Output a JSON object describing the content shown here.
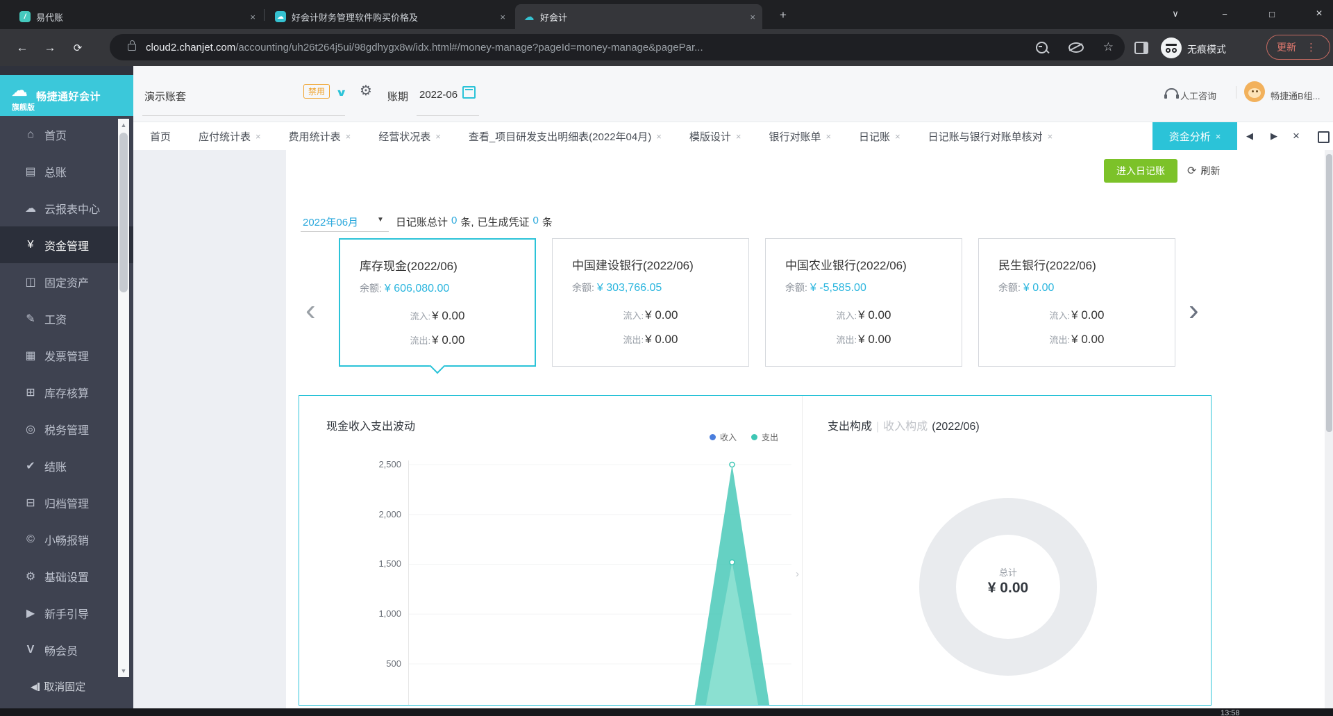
{
  "browser": {
    "tabs": [
      {
        "title": "易代账"
      },
      {
        "title": "好会计财务管理软件购买价格及"
      },
      {
        "title": "好会计"
      }
    ],
    "new_tab": "+",
    "close_glyph": "×",
    "window": {
      "tab_search": "∨",
      "minimize": "−",
      "maximize": "□",
      "close": "×"
    },
    "nav": {
      "back": "←",
      "forward": "→",
      "reload": "⟳"
    },
    "url": {
      "host": "cloud2.chanjet.com",
      "path": "/accounting/uh26t264j5ui/98gdhygx8w/idx.html#/money-manage?pageId=money-manage&pagePar..."
    },
    "star": "☆",
    "incognito_label": "无痕模式",
    "update_label": "更新",
    "menu_dots": "⋮"
  },
  "taskbar": {
    "time": "13:58"
  },
  "sidebar": {
    "logo_title": "畅捷通好会计",
    "logo_badge": "旗舰版",
    "logo_glyph": "☁",
    "items": [
      {
        "label": "首页",
        "icon": "home-icon",
        "glyph": "⌂"
      },
      {
        "label": "总账",
        "icon": "ledger-icon",
        "glyph": "▤"
      },
      {
        "label": "云报表中心",
        "icon": "cloud-report-icon",
        "glyph": "☁"
      },
      {
        "label": "资金管理",
        "icon": "money-icon",
        "glyph": "¥"
      },
      {
        "label": "固定资产",
        "icon": "fixed-asset-icon",
        "glyph": "◫"
      },
      {
        "label": "工资",
        "icon": "salary-icon",
        "glyph": "✎"
      },
      {
        "label": "发票管理",
        "icon": "invoice-icon",
        "glyph": "▦"
      },
      {
        "label": "库存核算",
        "icon": "inventory-icon",
        "glyph": "⊞"
      },
      {
        "label": "税务管理",
        "icon": "tax-icon",
        "glyph": "◎"
      },
      {
        "label": "结账",
        "icon": "closing-icon",
        "glyph": "✔"
      },
      {
        "label": "归档管理",
        "icon": "archive-icon",
        "glyph": "⊟"
      },
      {
        "label": "小畅报销",
        "icon": "reimburse-icon",
        "glyph": "©"
      },
      {
        "label": "基础设置",
        "icon": "settings-icon",
        "glyph": "⚙"
      },
      {
        "label": "新手引导",
        "icon": "guide-icon",
        "glyph": "▶"
      },
      {
        "label": "畅会员",
        "icon": "member-icon",
        "glyph": "V"
      }
    ],
    "unpin_label": "取消固定",
    "unpin_glyph": "◀"
  },
  "header": {
    "account_set": "演示账套",
    "disabled_badge": "禁用",
    "dropdown_glyph": "∨",
    "period_label": "账期",
    "period_value": "2022-06",
    "support_label": "人工咨询",
    "user_name": "畅捷通B组..."
  },
  "tabbar": {
    "close_glyph": "×",
    "tabs": [
      {
        "label": "首页"
      },
      {
        "label": "应付统计表"
      },
      {
        "label": "费用统计表"
      },
      {
        "label": "经营状况表"
      },
      {
        "label": "查看_项目研发支出明细表(2022年04月)"
      },
      {
        "label": "模版设计"
      },
      {
        "label": "银行对账单"
      },
      {
        "label": "日记账"
      },
      {
        "label": "日记账与银行对账单核对"
      },
      {
        "label": "资金分析"
      }
    ],
    "nav_left": "◀",
    "nav_right": "▶",
    "close_all": "×"
  },
  "toolbar": {
    "enter_journal": "进入日记账",
    "refresh_glyph": "⟳",
    "refresh": "刷新"
  },
  "summary": {
    "month": "2022年06月",
    "caret": "▼",
    "label_total": "日记账总计",
    "count_total": "0",
    "unit_a": "条,",
    "label_voucher": "已生成凭证",
    "count_voucher": "0",
    "unit_b": "条"
  },
  "carousel": {
    "prev": "‹",
    "next": "›"
  },
  "cards": [
    {
      "title": "库存现金(2022/06)",
      "balance_label": "余额:",
      "balance": "¥ 606,080.00",
      "inflow_label": "流入:",
      "inflow": "¥ 0.00",
      "outflow_label": "流出:",
      "outflow": "¥ 0.00"
    },
    {
      "title": "中国建设银行(2022/06)",
      "balance_label": "余额:",
      "balance": "¥ 303,766.05",
      "inflow_label": "流入:",
      "inflow": "¥ 0.00",
      "outflow_label": "流出:",
      "outflow": "¥ 0.00"
    },
    {
      "title": "中国农业银行(2022/06)",
      "balance_label": "余额:",
      "balance": "¥ -5,585.00",
      "inflow_label": "流入:",
      "inflow": "¥ 0.00",
      "outflow_label": "流出:",
      "outflow": "¥ 0.00"
    },
    {
      "title": "民生银行(2022/06)",
      "balance_label": "余额:",
      "balance": "¥ 0.00",
      "inflow_label": "流入:",
      "inflow": "¥ 0.00",
      "outflow_label": "流出:",
      "outflow": "¥ 0.00"
    }
  ],
  "wave_chart": {
    "title": "现金收入支出波动",
    "legend": [
      {
        "label": "收入",
        "color": "#4a7edd"
      },
      {
        "label": "支出",
        "color": "#3ec6b4"
      }
    ],
    "yticks": [
      "2,500",
      "2,000",
      "1,500",
      "1,000",
      "500"
    ]
  },
  "pie_chart": {
    "tab_expense": "支出构成",
    "separator": "|",
    "tab_income": "收入构成",
    "period": "(2022/06)",
    "center_label": "总计",
    "center_value": "¥ 0.00"
  },
  "colors": {
    "accent_cyan": "#2bc3d8",
    "accent_green": "#7cc229",
    "accent_orange": "#f0a32c",
    "link_blue": "#2aa8dc",
    "spike_teal_back": "#3ec6b4",
    "spike_teal_front": "#8de0d2",
    "donut_gray": "#e9ebee"
  },
  "chart_data": [
    {
      "type": "area",
      "title": "现金收入支出波动",
      "legend_entries": [
        "收入",
        "支出"
      ],
      "legend_position": "top-right",
      "ylim": [
        0,
        2500
      ],
      "yticks": [
        500,
        1000,
        1500,
        2000,
        2500
      ],
      "xlabel": "",
      "ylabel": "",
      "grid": false,
      "series": [
        {
          "name": "支出",
          "color": "#3ec6b4",
          "note": "flat at 0 except one sharp spike",
          "spike_values": [
            2500
          ]
        },
        {
          "name": "收入",
          "color": "#8de0d2",
          "note": "flat at 0 except one sharp spike at same x",
          "spike_values": [
            1520
          ]
        }
      ],
      "spike_x_fraction": 0.83,
      "x_tick_labels_visible": false
    },
    {
      "type": "pie",
      "title": "支出构成 | 收入构成 (2022/06)",
      "center_label": "总计",
      "center_value": "¥ 0.00",
      "segments": [],
      "note": "empty gray donut ring, no data"
    }
  ]
}
